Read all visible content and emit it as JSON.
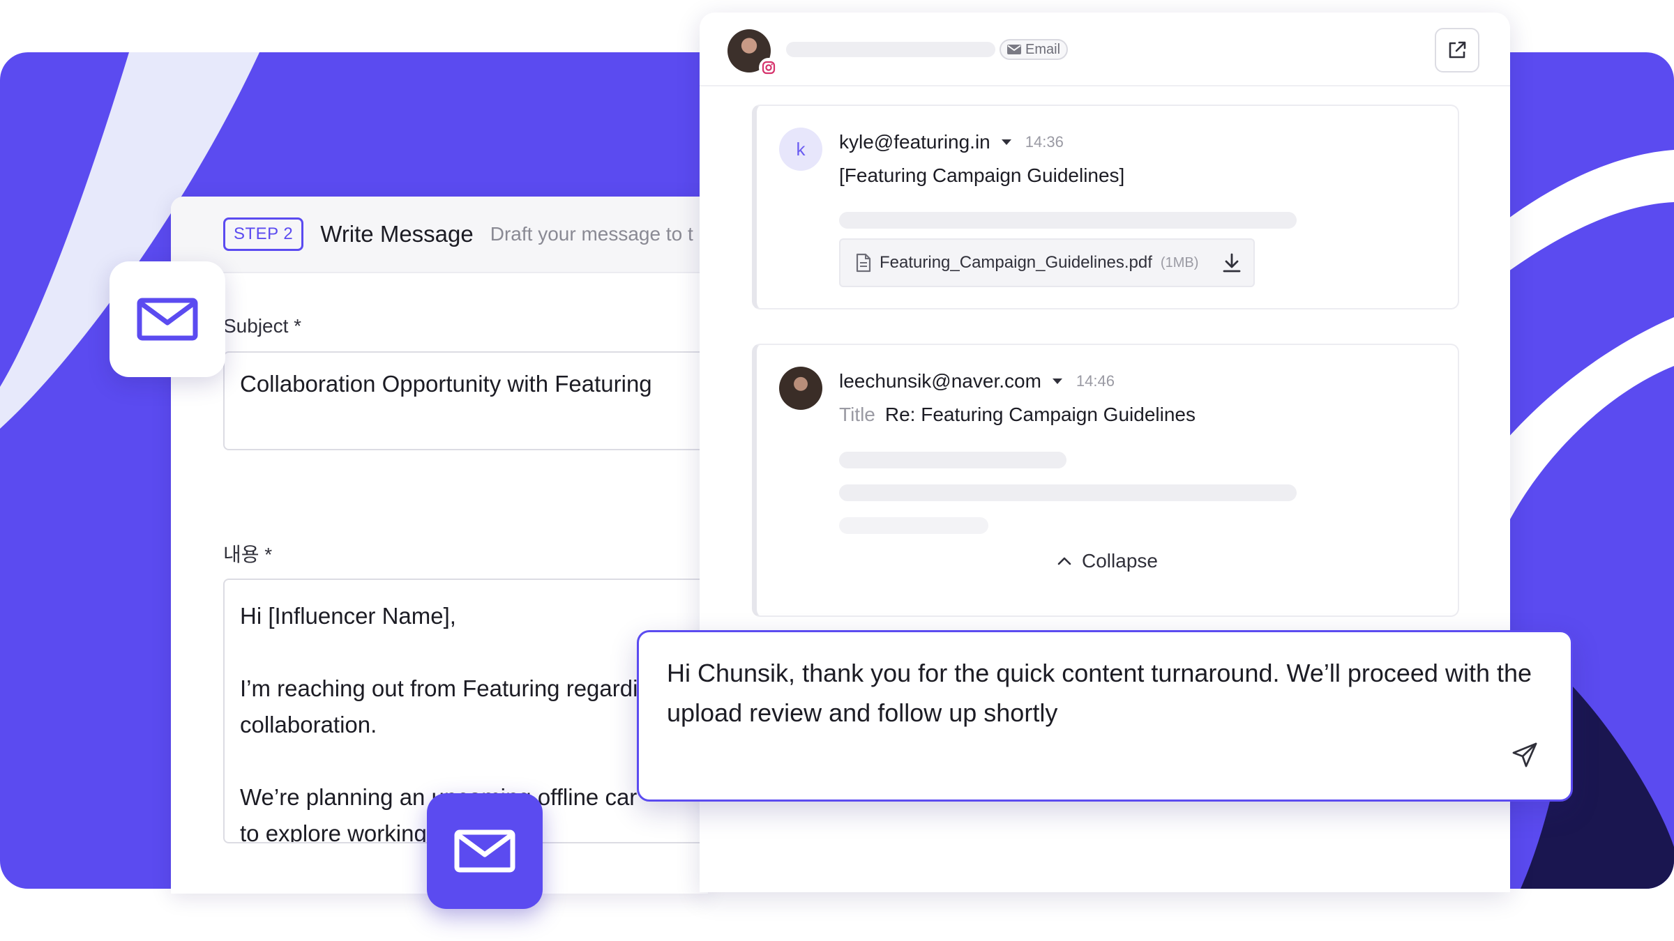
{
  "colors": {
    "brand_purple": "#5b4bf0",
    "dark_navy": "#1a1650",
    "light_lavender": "#e7e9fb"
  },
  "compose_form": {
    "step_badge": "STEP 2",
    "title": "Write Message",
    "description": "Draft your message to t",
    "subject_label": "Subject *",
    "subject_value": "Collaboration Opportunity with Featuring",
    "content_label": "내용 *",
    "content_lines": [
      "Hi [Influencer Name],",
      "I’m reaching out from Featuring regardi",
      "collaboration.",
      "We’re planning an upcoming offline car",
      "to explore working"
    ]
  },
  "mail_tiles": {
    "icon": "mail-icon"
  },
  "thread": {
    "channel_label": "Email",
    "channel_icon": "mail-icon",
    "source_badge_icon": "instagram-icon",
    "open_external_icon": "external-link-icon",
    "messages": [
      {
        "avatar_letter": "k",
        "sender": "kyle@featuring.in",
        "time": "14:36",
        "subject": "[Featuring Campaign Guidelines]",
        "attachment": {
          "name": "Featuring_Campaign_Guidelines.pdf",
          "size": "(1MB)",
          "icon": "file-icon",
          "action_icon": "download-icon"
        }
      },
      {
        "sender": "leechunsik@naver.com",
        "time": "14:46",
        "title_label": "Title",
        "title_value": "Re: Featuring Campaign Guidelines",
        "collapse_label": "Collapse",
        "collapse_icon": "chevron-up-icon"
      }
    ]
  },
  "reply": {
    "text": "Hi Chunsik, thank you for the quick content turnaround. We’ll proceed with the upload review and follow up shortly",
    "send_icon": "send-icon"
  }
}
